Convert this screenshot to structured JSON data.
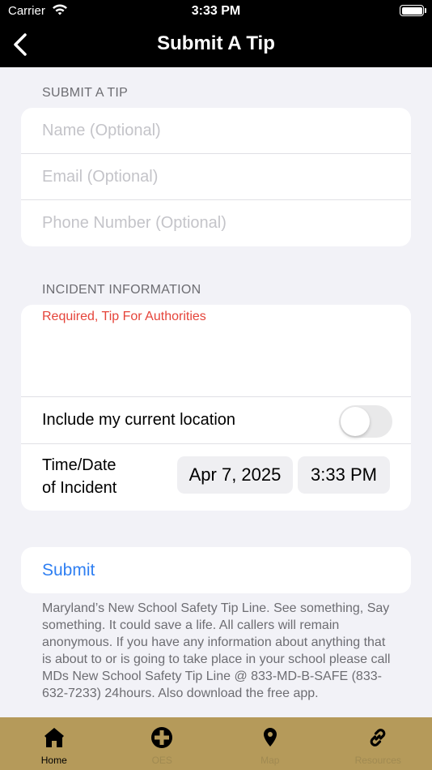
{
  "status_bar": {
    "carrier": "Carrier",
    "time": "3:33 PM"
  },
  "nav": {
    "title": "Submit A Tip",
    "back_icon": "chevron-left-icon"
  },
  "contact_section": {
    "header": "SUBMIT A TIP",
    "fields": [
      {
        "placeholder": "Name (Optional)",
        "value": ""
      },
      {
        "placeholder": "Email (Optional)",
        "value": ""
      },
      {
        "placeholder": "Phone Number (Optional)",
        "value": ""
      }
    ]
  },
  "incident_section": {
    "header": "INCIDENT INFORMATION",
    "tip_placeholder": "Required, Tip For Authorities",
    "location_label": "Include my current location",
    "location_enabled": false,
    "time_label_line1": "Time/Date",
    "time_label_line2": "of Incident",
    "date_value": "Apr 7, 2025",
    "time_value": "3:33 PM"
  },
  "submit": {
    "label": "Submit"
  },
  "footer_text": "Maryland’s New School Safety Tip Line. See something, Say something. It could save a life. All callers will remain anonymous. If you have any information about anything that is about to or is going to take place in your school please call MDs New School Safety Tip Line @ 833-MD-B-SAFE (833-632-7233) 24hours. Also download the free app.",
  "tabs": [
    {
      "label": "Home",
      "icon": "home-icon",
      "active": true
    },
    {
      "label": "OES",
      "icon": "plus-circle-icon",
      "active": false
    },
    {
      "label": "Map",
      "icon": "map-pin-icon",
      "active": false
    },
    {
      "label": "Resources",
      "icon": "link-icon",
      "active": false
    }
  ],
  "colors": {
    "accent": "#2f7ff2",
    "tab_bar": "#b59a5a",
    "required": "#e5443a"
  }
}
